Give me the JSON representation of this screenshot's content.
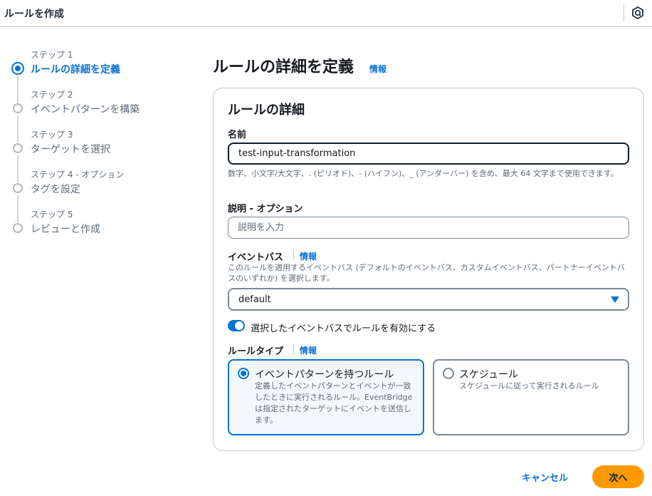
{
  "header": {
    "title": "ルールを作成",
    "help_icon": "help-circle-icon"
  },
  "steps": [
    {
      "num": "ステップ 1",
      "label": "ルールの詳細を定義",
      "active": true
    },
    {
      "num": "ステップ 2",
      "label": "イベントパターンを構築",
      "active": false
    },
    {
      "num": "ステップ 3",
      "label": "ターゲットを選択",
      "active": false
    },
    {
      "num": "ステップ 4 - オプション",
      "label": "タグを設定",
      "active": false
    },
    {
      "num": "ステップ 5",
      "label": "レビューと作成",
      "active": false
    }
  ],
  "page": {
    "title": "ルールの詳細を定義",
    "info": "情報"
  },
  "card": {
    "title": "ルールの詳細",
    "name": {
      "label": "名前",
      "value": "test-input-transformation",
      "hint": "数字、小文字/大文字、. (ピリオド)、- (ハイフン)、_ (アンダーバー) を含め、最大 64 文字まで使用できます。"
    },
    "description": {
      "label": "説明 - オプション",
      "placeholder": "説明を入力"
    },
    "event_bus": {
      "label": "イベントバス",
      "info": "情報",
      "hint": "このルールを適用するイベントバス (デフォルトのイベントバス、カスタムイベントバス、パートナーイベントバスのいずれか) を選択します。",
      "selected": "default"
    },
    "toggle": {
      "label": "選択したイベントバスでルールを有効にする",
      "enabled": true
    },
    "rule_type": {
      "label": "ルールタイプ",
      "info": "情報",
      "options": [
        {
          "title": "イベントパターンを持つルール",
          "desc": "定義したイベントパターンとイベントが一致したときに実行されるルール。EventBridge は指定されたターゲットにイベントを送信します。",
          "selected": true
        },
        {
          "title": "スケジュール",
          "desc": "スケジュールに従って実行されるルール",
          "selected": false
        }
      ]
    }
  },
  "footer": {
    "cancel": "キャンセル",
    "next": "次へ"
  },
  "colors": {
    "accent": "#0972d3",
    "primary_button": "#ff9900",
    "text": "#16191f",
    "muted": "#5f6b7a"
  }
}
